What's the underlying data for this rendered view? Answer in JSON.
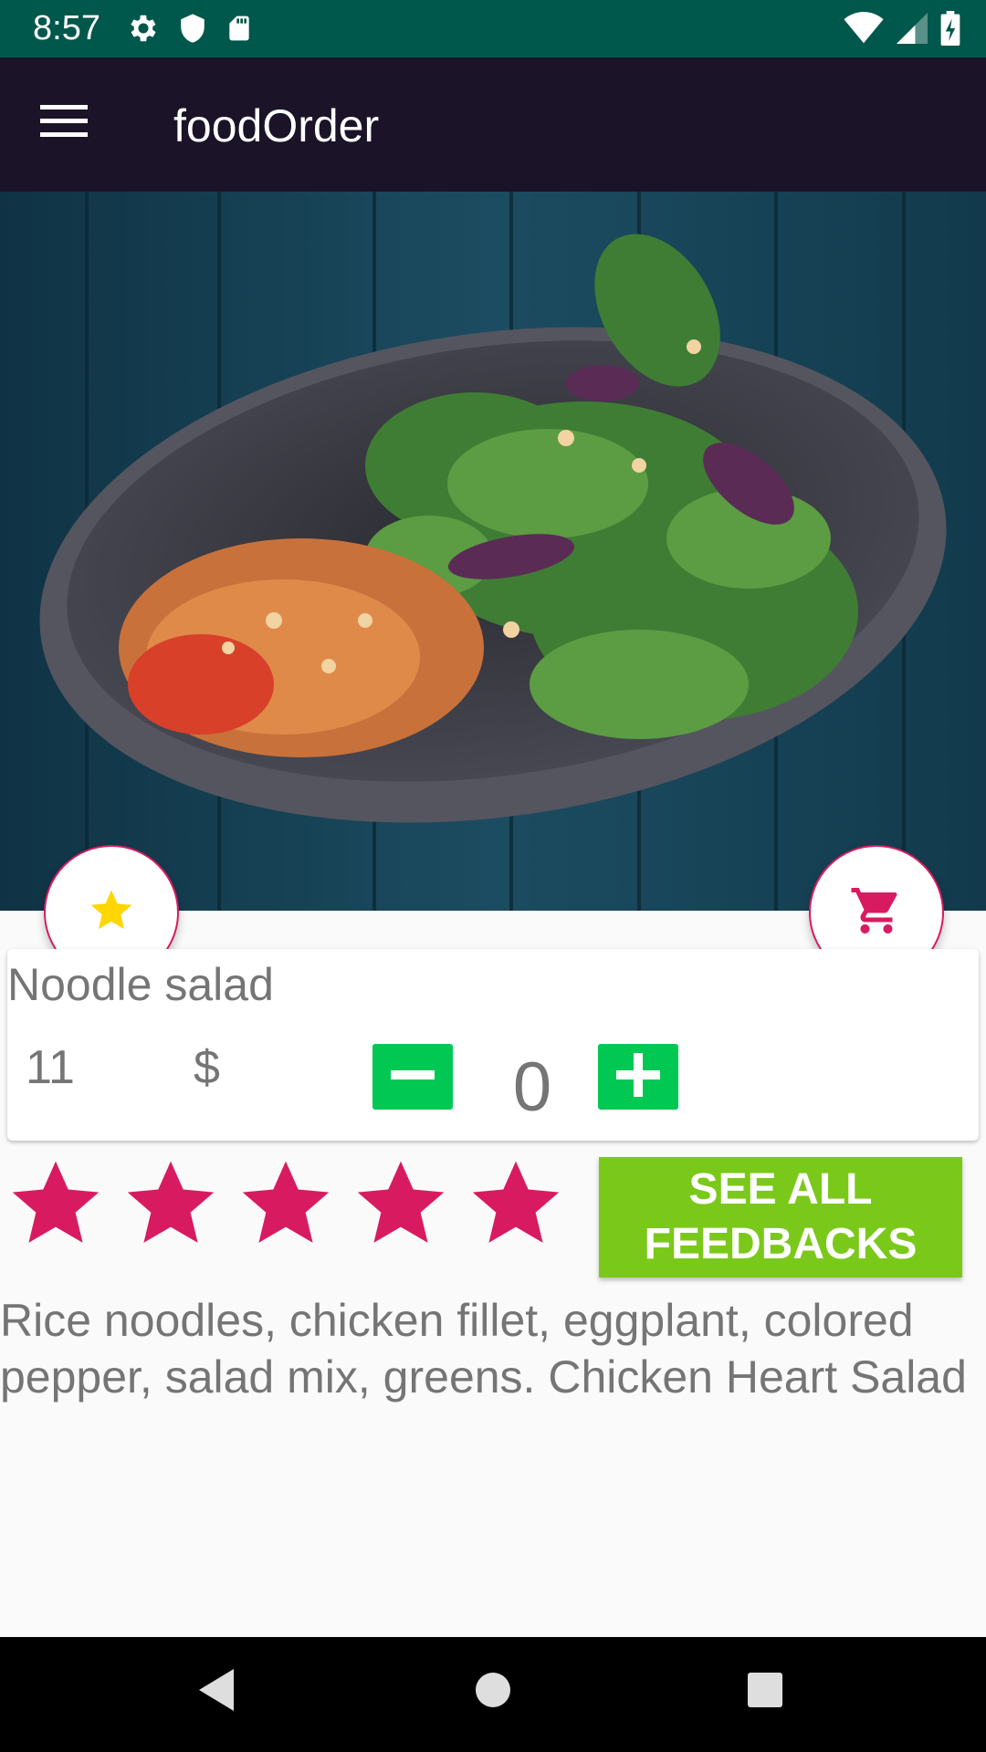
{
  "status_bar": {
    "time": "8:57",
    "left_icons": [
      "settings-icon",
      "shield-icon",
      "sd-card-icon"
    ],
    "right_icons": [
      "wifi-icon",
      "signal-icon",
      "battery-icon"
    ]
  },
  "app_bar": {
    "title": "foodOrder",
    "menu_icon": "hamburger-menu-icon"
  },
  "product": {
    "image": "noodle-salad-bowl-photo",
    "name": "Noodle salad",
    "price": "11",
    "currency": "$",
    "quantity": "0",
    "rating": {
      "value": 5,
      "max": 5,
      "color": "#d81b60"
    },
    "description": "Rice noodles, chicken fillet, eggplant, colored pepper, salad mix, greens. Chicken Heart Salad"
  },
  "actions": {
    "favorite_icon": "star-icon",
    "cart_icon": "shopping-cart-icon",
    "see_all_feedbacks": "SEE ALL FEEDBACKS",
    "decrease_icon": "minus-icon",
    "increase_icon": "plus-icon"
  },
  "nav_bar": {
    "items": [
      "back-icon",
      "home-icon",
      "recents-icon"
    ]
  },
  "colors": {
    "status_bar": "#00574b",
    "app_bar": "#1b1428",
    "accent": "#d81b60",
    "quantity_button": "#00c853",
    "feedback_button": "#7ac91a",
    "favorite_star": "#ffd600"
  }
}
